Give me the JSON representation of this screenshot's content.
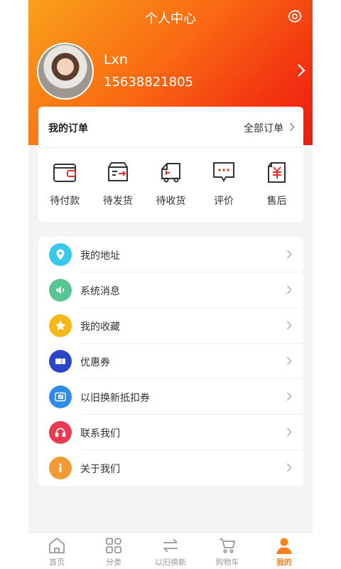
{
  "colors": {
    "accent": "#f5821e",
    "header_start": "#f9a11b",
    "header_end": "#ee1a12"
  },
  "header": {
    "title": "个人中心",
    "settings_icon": "gear-icon"
  },
  "profile": {
    "name": "Lxn",
    "phone": "15638821805"
  },
  "orders": {
    "title": "我的订单",
    "all_label": "全部订单",
    "statuses": [
      {
        "label": "待付款",
        "icon": "wallet-icon"
      },
      {
        "label": "待发货",
        "icon": "box-shipping-icon"
      },
      {
        "label": "待收货",
        "icon": "truck-icon"
      },
      {
        "label": "评价",
        "icon": "comment-icon"
      },
      {
        "label": "售后",
        "icon": "refund-icon"
      }
    ]
  },
  "menu": [
    {
      "label": "我的地址",
      "icon": "location-icon",
      "color": "#36c9e9"
    },
    {
      "label": "系统消息",
      "icon": "speaker-icon",
      "color": "#5ac594"
    },
    {
      "label": "我的收藏",
      "icon": "star-icon",
      "color": "#f7b619"
    },
    {
      "label": "优惠券",
      "icon": "coupon-icon",
      "color": "#2b45c9"
    },
    {
      "label": "以旧换新抵扣券",
      "icon": "trade-in-coupon-icon",
      "color": "#2f8be6"
    },
    {
      "label": "联系我们",
      "icon": "headset-icon",
      "color": "#e93c54"
    },
    {
      "label": "关于我们",
      "icon": "info-icon",
      "color": "#f19b36"
    }
  ],
  "tabs": [
    {
      "label": "首页",
      "icon": "home-icon",
      "active": false
    },
    {
      "label": "分类",
      "icon": "category-icon",
      "active": false
    },
    {
      "label": "以旧换新",
      "icon": "exchange-icon",
      "active": false
    },
    {
      "label": "购物车",
      "icon": "cart-icon",
      "active": false
    },
    {
      "label": "我的",
      "icon": "user-icon",
      "active": true
    }
  ]
}
